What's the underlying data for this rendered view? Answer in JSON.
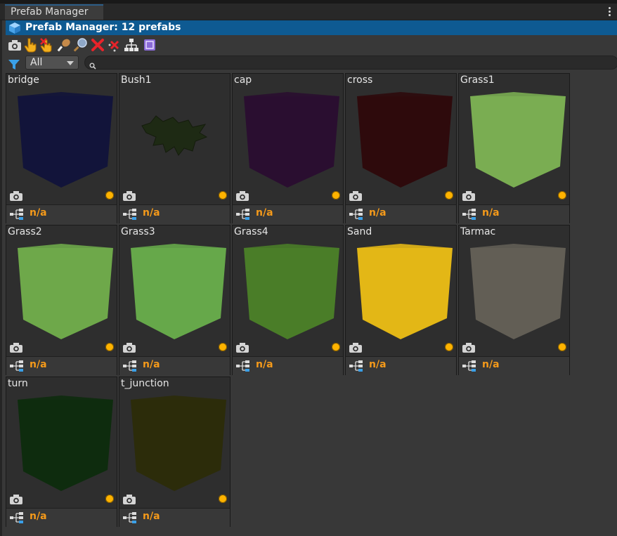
{
  "window": {
    "tab_label": "Prefab Manager"
  },
  "header": {
    "title": "Prefab Manager: 12 prefabs"
  },
  "toolbar": {
    "buttons": [
      "camera-icon",
      "pointer-hand-icon",
      "pointer-remove-icon",
      "drumstick-icon",
      "magnifier-icon",
      "red-x-icon",
      "remove-marker-icon",
      "hierarchy-icon",
      "prefab-dialog-icon"
    ]
  },
  "filter": {
    "selected": "All",
    "search_placeholder": ""
  },
  "prefabs": [
    {
      "name": "bridge",
      "color": "#12143a",
      "status": "n/a"
    },
    {
      "name": "Bush1",
      "color": "#1e2a14",
      "status": "n/a"
    },
    {
      "name": "cap",
      "color": "#2a0e30",
      "status": "n/a"
    },
    {
      "name": "cross",
      "color": "#2e0a0c",
      "status": "n/a"
    },
    {
      "name": "Grass1",
      "color": "#7aad52",
      "status": "n/a"
    },
    {
      "name": "Grass2",
      "color": "#6ea84a",
      "status": "n/a"
    },
    {
      "name": "Grass3",
      "color": "#66a84a",
      "status": "n/a"
    },
    {
      "name": "Grass4",
      "color": "#4a7d28",
      "status": "n/a"
    },
    {
      "name": "Sand",
      "color": "#e3b716",
      "status": "n/a"
    },
    {
      "name": "Tarmac",
      "color": "#625e55",
      "status": "n/a"
    },
    {
      "name": "turn",
      "color": "#0e2c0e",
      "status": "n/a"
    },
    {
      "name": "t_junction",
      "color": "#2c2c0a",
      "status": "n/a"
    }
  ]
}
